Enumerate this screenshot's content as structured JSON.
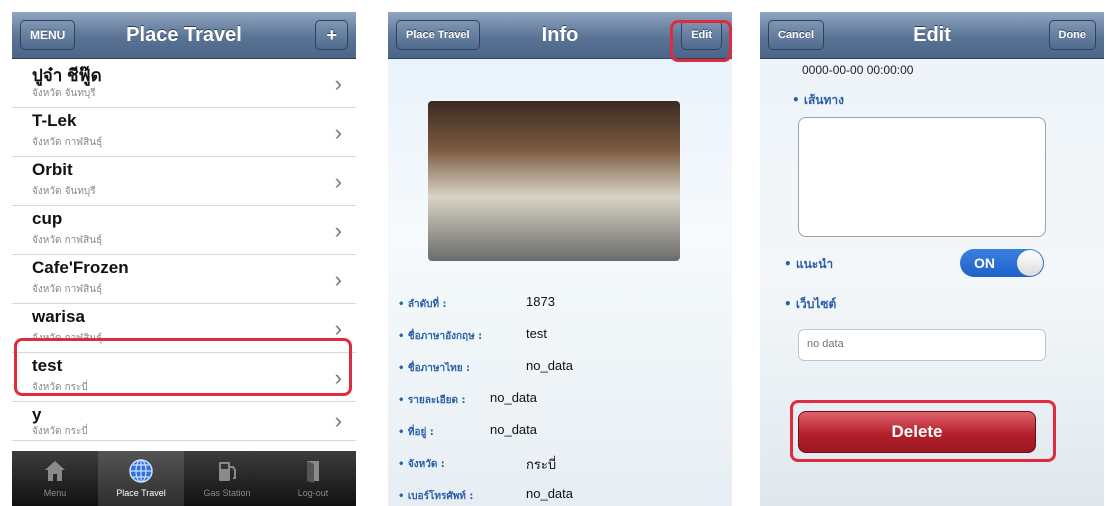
{
  "list_screen": {
    "title": "Place Travel",
    "menu_label": "MENU",
    "add_label": "+",
    "items": [
      {
        "name": "ปูจ๋า ชีฟู๊ด",
        "province": "จังหวัด จันทบุรี"
      },
      {
        "name": "T-Lek",
        "province": "จังหวัด กาฬสินธุ์"
      },
      {
        "name": "Orbit",
        "province": "จังหวัด จันทบุรี"
      },
      {
        "name": "cup",
        "province": "จังหวัด กาฬสินธุ์"
      },
      {
        "name": "Cafe'Frozen",
        "province": "จังหวัด กาฬสินธุ์"
      },
      {
        "name": "warisa",
        "province": "จังหวัด กาฬสินธุ์"
      },
      {
        "name": "test",
        "province": "จังหวัด กระบี่"
      },
      {
        "name": "y",
        "province": "จังหวัด กระบี่"
      }
    ],
    "tabs": [
      {
        "label": "Menu",
        "icon": "home-icon"
      },
      {
        "label": "Place Travel",
        "icon": "globe-icon"
      },
      {
        "label": "Gas Station",
        "icon": "gas-pump-icon"
      },
      {
        "label": "Log-out",
        "icon": "logout-icon"
      }
    ]
  },
  "info_screen": {
    "back_label": "Place Travel",
    "title": "Info",
    "edit_label": "Edit",
    "fields": [
      {
        "key": "• ลำดับที่ :",
        "value": "1873"
      },
      {
        "key": "• ชื่อภาษาอังกฤษ :",
        "value": "test"
      },
      {
        "key": "• ชื่อภาษาไทย :",
        "value": "no_data"
      },
      {
        "key": "• รายละเอียด :",
        "value": "no_data"
      },
      {
        "key": "• ที่อยู่ :",
        "value": "no_data"
      },
      {
        "key": "• จังหวัด :",
        "value": "กระบี่"
      },
      {
        "key": "• เบอร์โทรศัพท์ :",
        "value": "no_data"
      }
    ]
  },
  "edit_screen": {
    "cancel_label": "Cancel",
    "title": "Edit",
    "done_label": "Done",
    "datetime": "0000-00-00 00:00:00",
    "route_label": "• เส้นทาง",
    "recommend_label": "• แนะนำ",
    "toggle_label": "ON",
    "website_label": "• เว็บไซต์",
    "website_placeholder": "no data",
    "delete_label": "Delete"
  },
  "colors": {
    "highlight": "#e02a3d",
    "navbar": "#5a7395",
    "delete": "#b3202c"
  }
}
